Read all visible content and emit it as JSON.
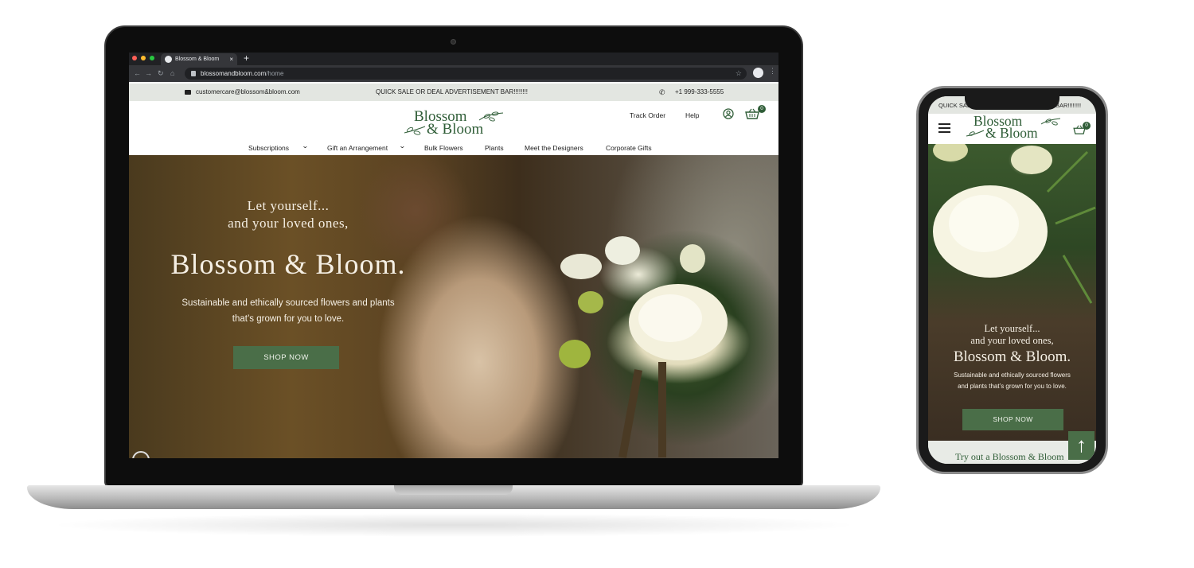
{
  "browser": {
    "tab_title": "Blossom & Bloom",
    "tab_close": "×",
    "new_tab": "+",
    "url_domain": "blossomandbloom.com",
    "url_path": "/home",
    "back": "←",
    "forward": "→",
    "reload": "↻",
    "home": "⌂",
    "star": "☆",
    "menu": "⋮"
  },
  "site": {
    "brand_line1": "Blossom",
    "brand_line2": "& Bloom",
    "accent_color": "#2f5d37",
    "button_color": "#4a6e48",
    "topbar": {
      "email": "customercare@blossom&bloom.com",
      "promo": "QUICK SALE OR DEAL ADVERTISEMENT BAR!!!!!!!!",
      "phone": "+1 999-333-5555"
    },
    "header": {
      "track_order": "Track Order",
      "help": "Help",
      "cart_count": "0"
    },
    "nav": {
      "subscriptions": "Subscriptions",
      "gift": "Gift an Arrangement",
      "bulk": "Bulk Flowers",
      "plants": "Plants",
      "designers": "Meet the Designers",
      "corporate": "Corporate Gifts",
      "caret": "⌄"
    },
    "hero": {
      "line1": "Let yourself...",
      "line2": "and your loved ones,",
      "title": "Blossom & Bloom.",
      "subtitle": "Sustainable and ethically sourced flowers and plants that’s grown for you to love.",
      "cta": "SHOP NOW"
    }
  },
  "mobile": {
    "topbar_promo": "QUICK SALE OR DEAL ADVERTISEMENT BAR!!!!!!!!",
    "cart_count": "0",
    "hero_line1": "Let yourself...",
    "hero_line2": "and your loved ones,",
    "hero_title": "Blossom & Bloom.",
    "hero_subtitle": "Sustainable and ethically sourced flowers and plants that’s grown for you to love.",
    "cta": "SHOP NOW",
    "section_heading": "Try out a Blossom & Bloom",
    "scroll_top": "↑"
  }
}
